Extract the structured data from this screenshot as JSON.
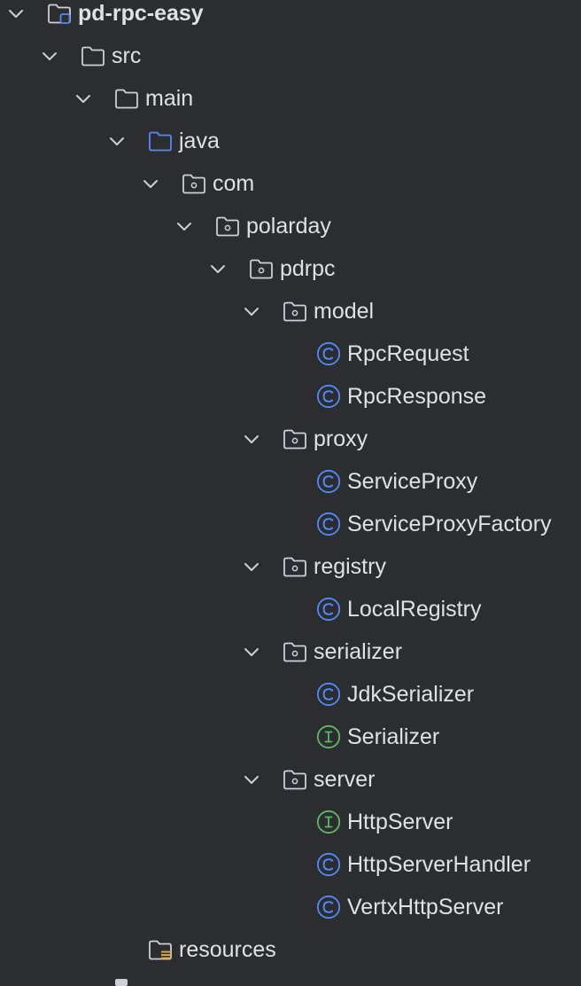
{
  "project_tree": {
    "rows": [
      {
        "label": "pd-rpc-easy",
        "depth": 0,
        "expanded": true,
        "icon": "module-folder-icon",
        "bold": true
      },
      {
        "label": "src",
        "depth": 1,
        "expanded": true,
        "icon": "folder-icon"
      },
      {
        "label": "main",
        "depth": 2,
        "expanded": true,
        "icon": "folder-icon"
      },
      {
        "label": "java",
        "depth": 3,
        "expanded": true,
        "icon": "source-folder-icon"
      },
      {
        "label": "com",
        "depth": 4,
        "expanded": true,
        "icon": "package-icon"
      },
      {
        "label": "polarday",
        "depth": 5,
        "expanded": true,
        "icon": "package-icon"
      },
      {
        "label": "pdrpc",
        "depth": 6,
        "expanded": true,
        "icon": "package-icon"
      },
      {
        "label": "model",
        "depth": 7,
        "expanded": true,
        "icon": "package-icon"
      },
      {
        "label": "RpcRequest",
        "depth": 8,
        "icon": "class-icon"
      },
      {
        "label": "RpcResponse",
        "depth": 8,
        "icon": "class-icon"
      },
      {
        "label": "proxy",
        "depth": 7,
        "expanded": true,
        "icon": "package-icon"
      },
      {
        "label": "ServiceProxy",
        "depth": 8,
        "icon": "class-icon"
      },
      {
        "label": "ServiceProxyFactory",
        "depth": 8,
        "icon": "class-icon"
      },
      {
        "label": "registry",
        "depth": 7,
        "expanded": true,
        "icon": "package-icon"
      },
      {
        "label": "LocalRegistry",
        "depth": 8,
        "icon": "class-icon"
      },
      {
        "label": "serializer",
        "depth": 7,
        "expanded": true,
        "icon": "package-icon"
      },
      {
        "label": "JdkSerializer",
        "depth": 8,
        "icon": "class-icon"
      },
      {
        "label": "Serializer",
        "depth": 8,
        "icon": "interface-icon"
      },
      {
        "label": "server",
        "depth": 7,
        "expanded": true,
        "icon": "package-icon"
      },
      {
        "label": "HttpServer",
        "depth": 8,
        "icon": "interface-icon"
      },
      {
        "label": "HttpServerHandler",
        "depth": 8,
        "icon": "class-icon"
      },
      {
        "label": "VertxHttpServer",
        "depth": 8,
        "icon": "class-icon"
      },
      {
        "label": "resources",
        "depth": 3,
        "icon": "resources-folder-icon"
      }
    ]
  },
  "colors": {
    "background": "#2b2d30",
    "text": "#dfe1e5",
    "chevron": "#ced0d6",
    "folder_stroke": "#ced0d6",
    "source_folder": "#548af7",
    "class_icon": "#548af7",
    "interface_icon": "#5fb865",
    "resources_badge": "#d9a343"
  }
}
